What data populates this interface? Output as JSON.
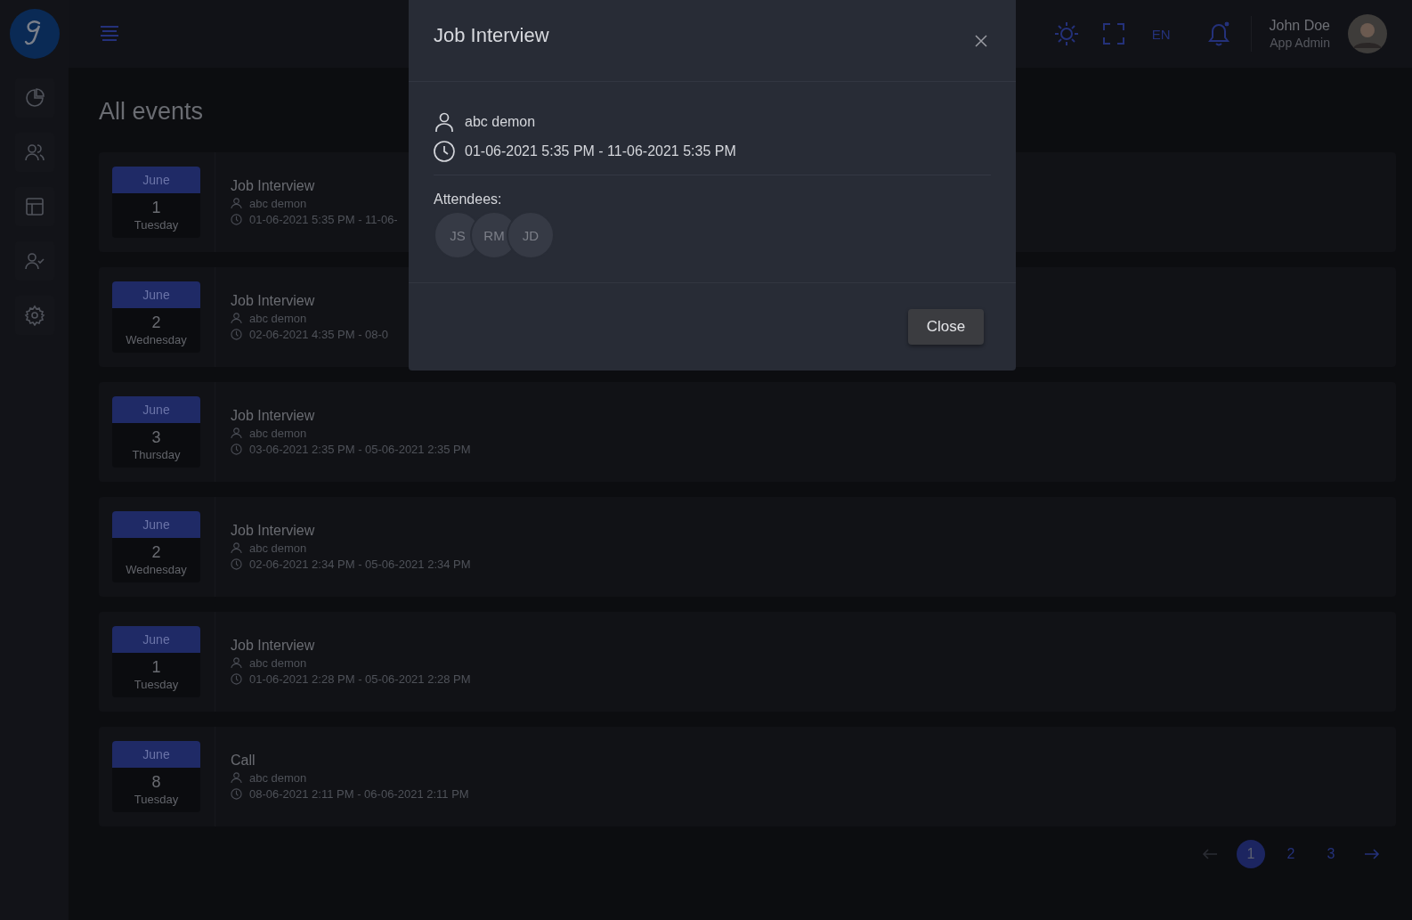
{
  "header": {
    "user_name": "John Doe",
    "user_role": "App Admin",
    "language": "EN",
    "has_unread_notifications": true
  },
  "page_title": "All events",
  "events": [
    {
      "month": "June",
      "day": "1",
      "weekday": "Tuesday",
      "title": "Job Interview",
      "person": "abc demon",
      "time": "01-06-2021 5:35 PM - 11-06-"
    },
    {
      "month": "June",
      "day": "2",
      "weekday": "Wednesday",
      "title": "Job Interview",
      "person": "abc demon",
      "time": "02-06-2021 4:35 PM - 08-0"
    },
    {
      "month": "June",
      "day": "3",
      "weekday": "Thursday",
      "title": "Job Interview",
      "person": "abc demon",
      "time": "03-06-2021 2:35 PM - 05-06-2021 2:35 PM"
    },
    {
      "month": "June",
      "day": "2",
      "weekday": "Wednesday",
      "title": "Job Interview",
      "person": "abc demon",
      "time": "02-06-2021 2:34 PM - 05-06-2021 2:34 PM"
    },
    {
      "month": "June",
      "day": "1",
      "weekday": "Tuesday",
      "title": "Job Interview",
      "person": "abc demon",
      "time": "01-06-2021 2:28 PM - 05-06-2021 2:28 PM"
    },
    {
      "month": "June",
      "day": "8",
      "weekday": "Tuesday",
      "title": "Call",
      "person": "abc demon",
      "time": "08-06-2021 2:11 PM - 06-06-2021 2:11 PM"
    }
  ],
  "pagination": {
    "previous_disabled": true,
    "next_disabled": false,
    "pages": [
      {
        "label": "1",
        "selected": true
      },
      {
        "label": "2",
        "selected": false
      },
      {
        "label": "3",
        "selected": false
      }
    ]
  },
  "modal": {
    "title": "Job Interview",
    "person": "abc demon",
    "time": "01-06-2021 5:35 PM - 11-06-2021 5:35 PM",
    "attendees_label": "Attendees:",
    "attendees": [
      "JS",
      "RM",
      "JD"
    ],
    "close_button": "Close"
  }
}
